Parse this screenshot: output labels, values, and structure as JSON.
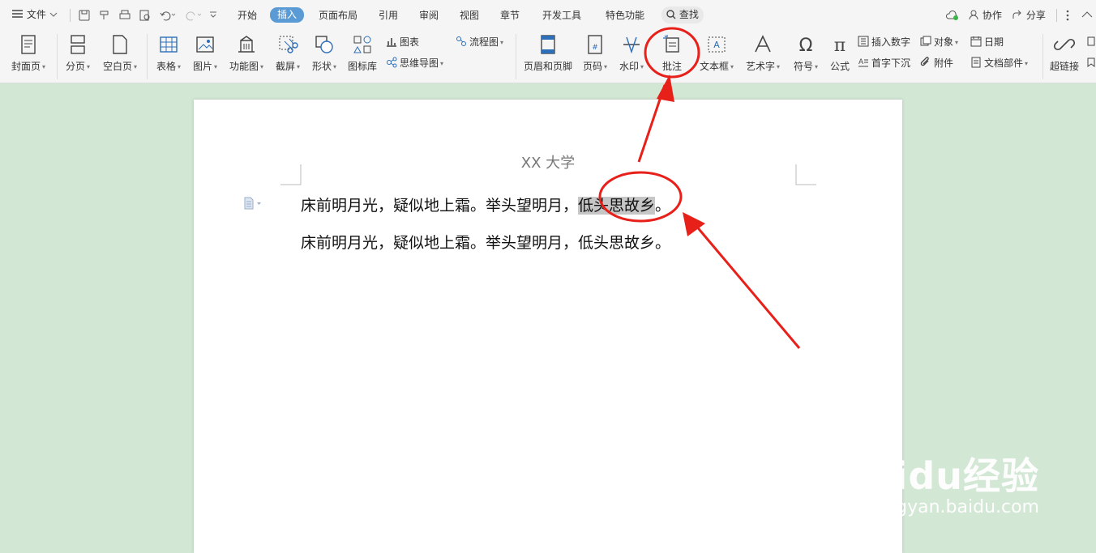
{
  "menu": {
    "file_label": "文件",
    "tabs": [
      "开始",
      "插入",
      "页面布局",
      "引用",
      "审阅",
      "视图",
      "章节",
      "开发工具",
      "特色功能"
    ],
    "active_tab": "插入",
    "search_label": "查找",
    "right": {
      "collab": "协作",
      "share": "分享"
    }
  },
  "ribbon": {
    "cover": "封面页",
    "page_break": "分页",
    "blank_page": "空白页",
    "table": "表格",
    "picture": "图片",
    "function_chart": "功能图",
    "screenshot": "截屏",
    "shapes": "形状",
    "icon_library": "图标库",
    "chart": "图表",
    "mind_map": "思维导图",
    "flowchart": "流程图",
    "header_footer": "页眉和页脚",
    "page_number": "页码",
    "watermark": "水印",
    "comment": "批注",
    "text_box": "文本框",
    "word_art": "艺术字",
    "symbol": "符号",
    "formula": "公式",
    "insert_number": "插入数字",
    "drop_cap": "首字下沉",
    "object": "对象",
    "attachment": "附件",
    "date": "日期",
    "doc_parts": "文档部件",
    "hyperlink": "超链接"
  },
  "document": {
    "header": "XX 大学",
    "line1_before": "床前明月光，疑似地上霜。举头望明月，",
    "line1_selected": "低头思故乡",
    "line1_after": "。",
    "line2": "床前明月光，疑似地上霜。举头望明月，低头思故乡。"
  },
  "watermark": {
    "brand": "Baidu经验",
    "url": "jingyan.baidu.com"
  },
  "colors": {
    "background": "#d3e7d5",
    "accent": "#5b9bd5",
    "annotation": "#e8201a",
    "selection": "#c6c6c6"
  }
}
